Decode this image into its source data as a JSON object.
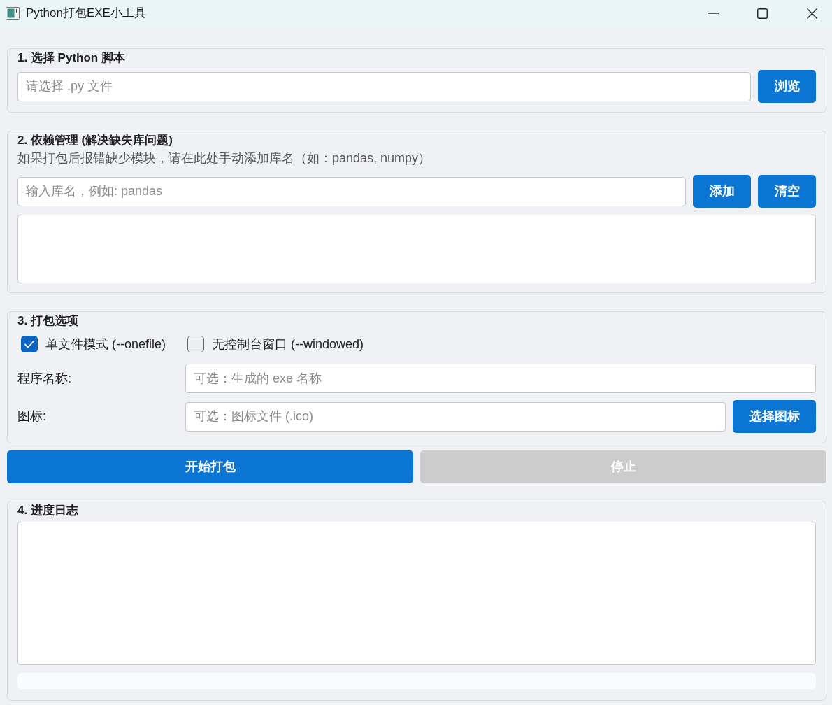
{
  "window": {
    "title": "Python打包EXE小工具"
  },
  "script_section": {
    "title": "1. 选择 Python 脚本",
    "path_field": {
      "placeholder": "请选择 .py 文件"
    },
    "browse_button": "浏览"
  },
  "dependencies_section": {
    "title": "2. 依赖管理 (解决缺失库问题)",
    "hint": "如果打包后报错缺少模块，请在此处手动添加库名（如：pandas, numpy）",
    "library_field": {
      "placeholder": "输入库名，例如: pandas"
    },
    "buttons": [
      "添加",
      "清空"
    ]
  },
  "options_section": {
    "title": "3. 打包选项",
    "checkboxes": [
      {
        "label": "单文件模式 (--onefile)",
        "checked": true
      },
      {
        "label": "无控制台窗口 (--windowed)",
        "checked": false
      }
    ],
    "fields": [
      {
        "label": "程序名称:",
        "placeholder": "可选：生成的 exe 名称"
      },
      {
        "label": "图标:",
        "placeholder": "可选：图标文件 (.ico)",
        "button": "选择图标"
      }
    ]
  },
  "actions": [
    {
      "label": "开始打包",
      "disabled": false
    },
    {
      "label": "停止",
      "disabled": true
    }
  ],
  "log_section": {
    "title": "4. 进度日志",
    "progress": {
      "level": 0
    }
  }
}
